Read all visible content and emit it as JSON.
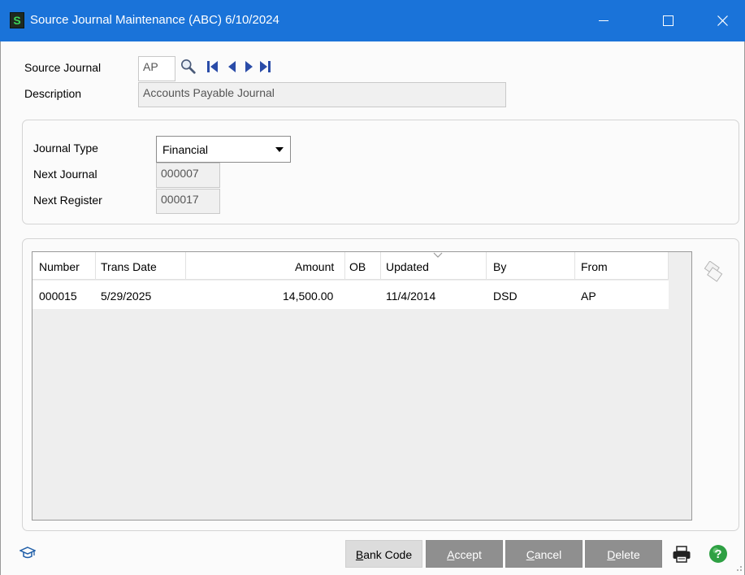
{
  "window": {
    "app_icon_letter": "S",
    "title": "Source Journal Maintenance (ABC) 6/10/2024"
  },
  "header": {
    "source_journal_label": "Source Journal",
    "source_journal_value": "AP",
    "description_label": "Description",
    "description_value": "Accounts Payable Journal"
  },
  "journal": {
    "type_label": "Journal Type",
    "type_value": "Financial",
    "next_journal_label": "Next Journal",
    "next_journal_value": "000007",
    "next_register_label": "Next Register",
    "next_register_value": "000017"
  },
  "grid": {
    "columns": [
      "Number",
      "Trans Date",
      "Amount",
      "OB",
      "Updated",
      "By",
      "From"
    ],
    "rows": [
      [
        "000015",
        "5/29/2025",
        "14,500.00",
        "",
        "11/4/2014",
        "DSD",
        "AP"
      ]
    ]
  },
  "buttons": {
    "bank_code_mnemonic": "B",
    "bank_code_rest": "ank Code",
    "accept_mnemonic": "A",
    "accept_rest": "ccept",
    "cancel_mnemonic": "C",
    "cancel_rest": "ancel",
    "delete_mnemonic": "D",
    "delete_rest": "elete"
  },
  "colors": {
    "titlebar": "#1a73d9",
    "app_icon_green": "#3cd65a",
    "help_green": "#2ea043"
  }
}
